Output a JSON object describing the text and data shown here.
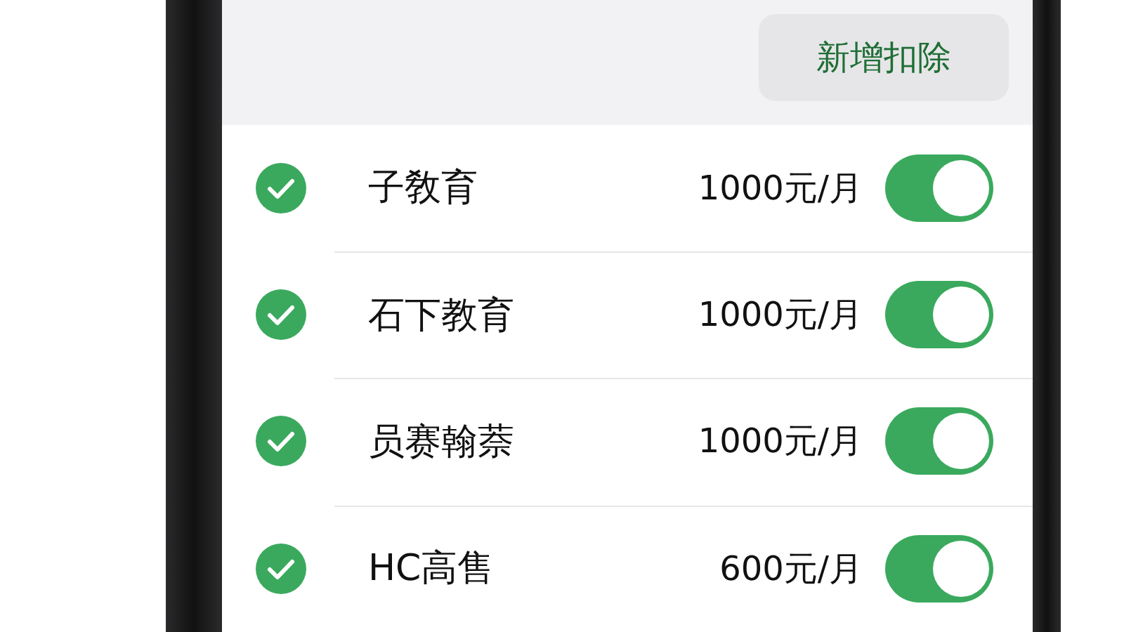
{
  "header": {
    "add_button": "新增扣除"
  },
  "deductions": [
    {
      "name": "子敎育",
      "amount": "1000元/月",
      "checked": true,
      "on": true
    },
    {
      "name": "石下教育",
      "amount": "1000元/月",
      "checked": true,
      "on": true
    },
    {
      "name": "员赛翰萘",
      "amount": "1000元/月",
      "checked": true,
      "on": true
    },
    {
      "name": "HC高售",
      "amount": "600元/月",
      "checked": true,
      "on": true
    }
  ]
}
